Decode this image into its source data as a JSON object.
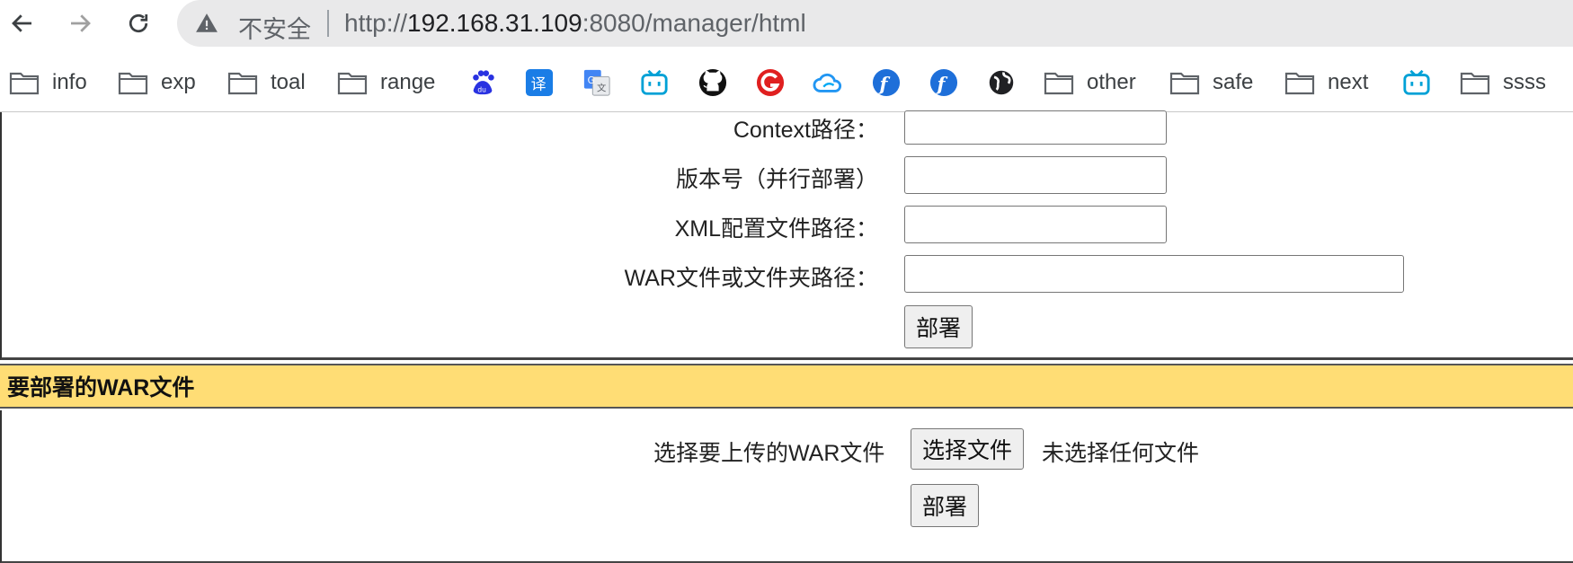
{
  "browser": {
    "security_label": "不安全",
    "url_prefix": "http://",
    "url_host": "192.168.31.109",
    "url_rest": ":8080/manager/html"
  },
  "bookmarks": [
    {
      "type": "folder",
      "label": "info"
    },
    {
      "type": "folder",
      "label": "exp"
    },
    {
      "type": "folder",
      "label": "toal"
    },
    {
      "type": "folder",
      "label": "range"
    },
    {
      "type": "icon",
      "icon": "baidu-icon"
    },
    {
      "type": "icon",
      "icon": "translate-icon"
    },
    {
      "type": "icon",
      "icon": "google-translate-icon"
    },
    {
      "type": "icon",
      "icon": "bilibili-icon"
    },
    {
      "type": "icon",
      "icon": "github-icon"
    },
    {
      "type": "icon",
      "icon": "g-red-icon"
    },
    {
      "type": "icon",
      "icon": "cloud-icon"
    },
    {
      "type": "icon",
      "icon": "f-blue-icon"
    },
    {
      "type": "icon",
      "icon": "f-blue-icon-2"
    },
    {
      "type": "icon",
      "icon": "globe-icon"
    },
    {
      "type": "folder",
      "label": "other"
    },
    {
      "type": "folder",
      "label": "safe"
    },
    {
      "type": "folder",
      "label": "next"
    },
    {
      "type": "icon",
      "icon": "bilibili-icon-2"
    },
    {
      "type": "folder",
      "label": "ssss"
    }
  ],
  "deploy_form": {
    "context_label": "Context路径：",
    "version_label": "版本号（并行部署）",
    "xml_label": "XML配置文件路径：",
    "war_label": "WAR文件或文件夹路径：",
    "deploy_button": "部署"
  },
  "war_section": {
    "title": "要部署的WAR文件",
    "upload_label": "选择要上传的WAR文件",
    "choose_button": "选择文件",
    "no_file_text": "未选择任何文件",
    "deploy_button": "部署"
  },
  "colors": {
    "section_header_bg": "#ffdd75",
    "button_bg": "#efefef"
  }
}
